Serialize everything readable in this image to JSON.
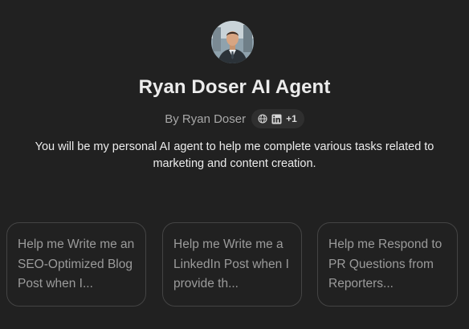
{
  "gpt": {
    "name": "Ryan Doser AI Agent",
    "author": "By Ryan Doser",
    "links": {
      "icons": [
        "globe-icon",
        "linkedin-icon"
      ],
      "more_count": "+1"
    },
    "description": "You will be my personal AI agent to help me complete various tasks related to marketing and content creation."
  },
  "conversation_starters": [
    {
      "label": "Help me Write me an SEO-Optimized Blog Post when I..."
    },
    {
      "label": "Help me Write me a LinkedIn Post when I provide th..."
    },
    {
      "label": "Help me Respond to PR Questions from Reporters..."
    }
  ],
  "colors": {
    "background": "#212121",
    "card_border": "#444444",
    "pill_background": "#2f2f2f",
    "text_primary": "#ececec",
    "text_muted": "#9b9b9b"
  }
}
